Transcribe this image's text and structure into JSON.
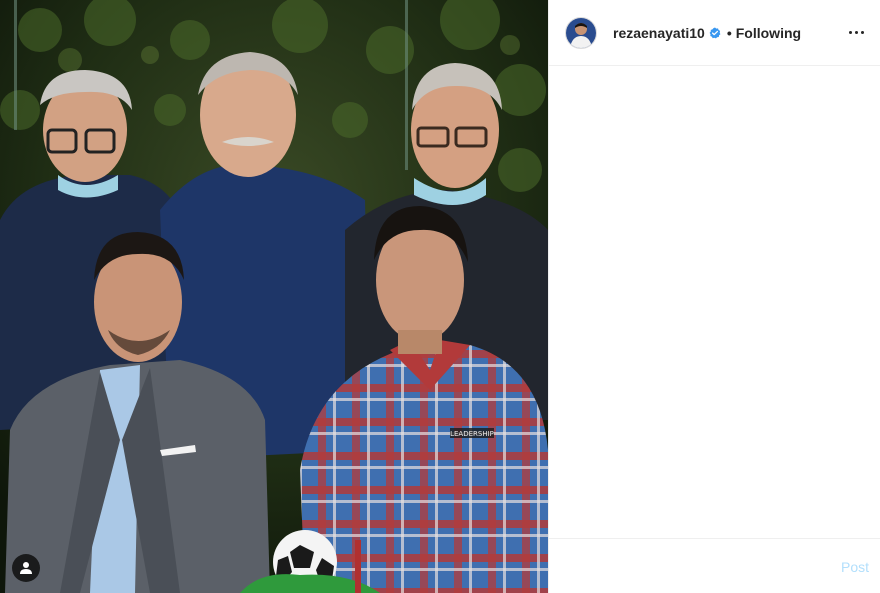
{
  "header": {
    "username": "rezaenayati10",
    "separator": "•",
    "follow_status": "Following",
    "more_icon": "more-horizontal-icon",
    "verified_icon": "verified-badge-icon"
  },
  "photo": {
    "tag_icon": "user-tag-icon",
    "shirt_text": "LEADERSHIP"
  },
  "comment": {
    "placeholder": "",
    "post_label": "Post",
    "post_color": "#b2dffc"
  },
  "colors": {
    "verified": "#3897f0",
    "border": "#efefef"
  }
}
